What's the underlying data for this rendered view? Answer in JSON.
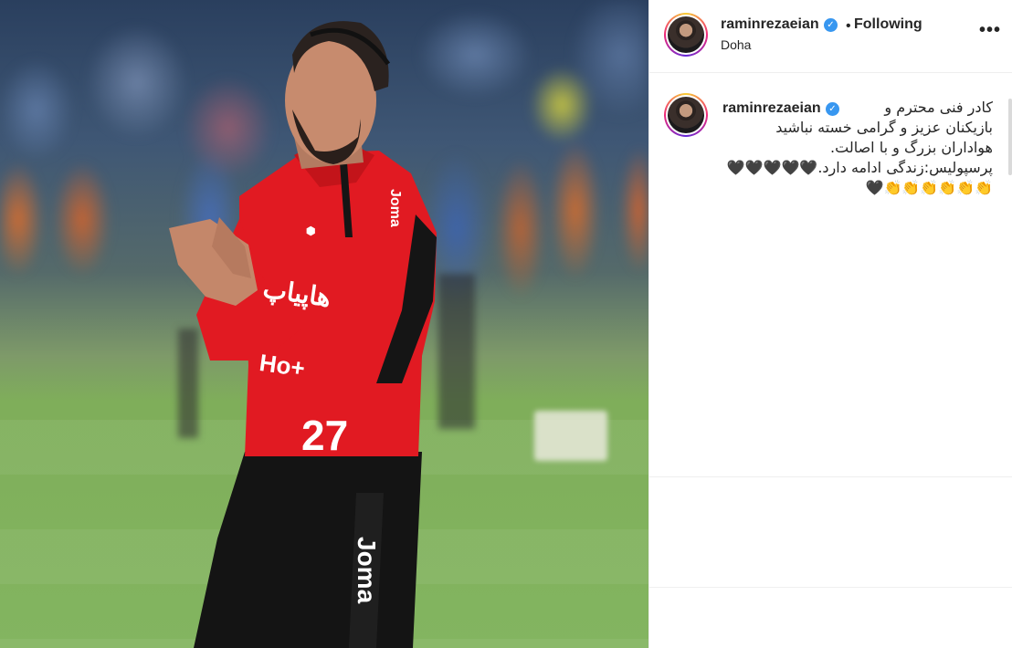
{
  "post": {
    "username": "raminrezaeian",
    "verified_icon": "verified-badge-icon",
    "separator": "•",
    "follow_status": "Following",
    "location": "Doha",
    "more_icon": "more-options-icon",
    "more_label": "•••"
  },
  "caption": {
    "username": "raminrezaeian",
    "lines": [
      "کادر فنی محترم و",
      "بازیکنان عزیز و گرامی خسته نباشید",
      "هواداران بزرگ و با اصالت.",
      "پرسپولیس:زندگی ادامه دارد.🖤🖤🖤🖤🖤",
      "👏👏👏👏👏👏🖤"
    ]
  },
  "photo": {
    "jersey_number": "27",
    "jersey_brand": "Joma"
  },
  "colors": {
    "verified": "#3897f0",
    "jersey": "#e11a22",
    "text": "#262626",
    "divider": "#efefef"
  }
}
